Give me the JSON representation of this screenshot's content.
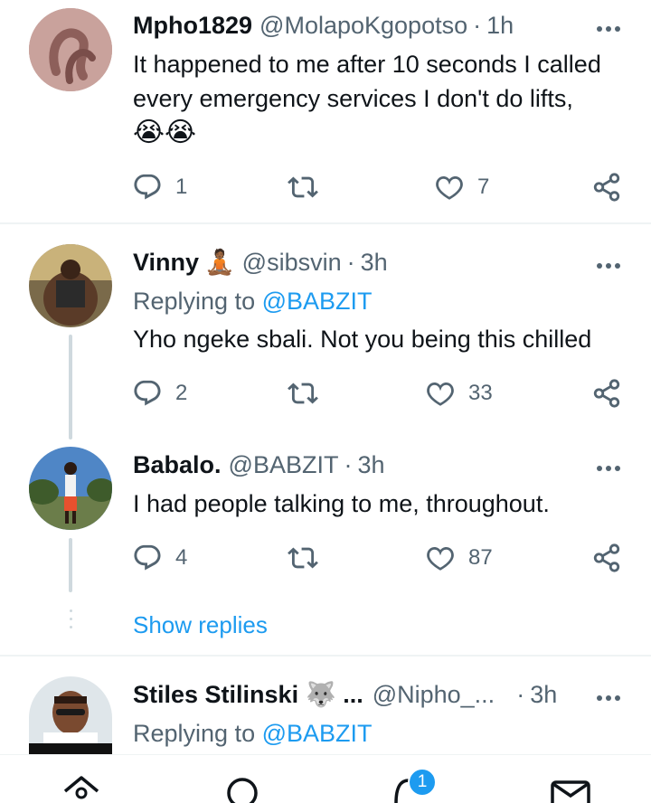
{
  "tweets": [
    {
      "name": "Mpho1829",
      "emoji_after_name": "",
      "handle": "@MolapoKgopotso",
      "dot": "·",
      "time": "1h",
      "text": "It happened to me after 10 seconds I called every emergency services I don't do lifts,",
      "emojis": "😭😭",
      "replies": "1",
      "retweets": "",
      "likes": "7"
    },
    {
      "name": "Vinny",
      "emoji_after_name": "🧘🏾",
      "handle": "@sibsvin",
      "dot": "·",
      "time": "3h",
      "replying_label": "Replying to",
      "replying_mention": "@BABZIT",
      "text": "Yho ngeke sbali. Not you being this chilled",
      "replies": "2",
      "retweets": "",
      "likes": "33"
    },
    {
      "name": "Babalo.",
      "handle": "@BABZIT",
      "dot": "·",
      "time": "3h",
      "text": "I had people talking to me, throughout.",
      "replies": "4",
      "retweets": "",
      "likes": "87"
    },
    {
      "name": "Stiles Stilinski",
      "emoji_after_name": "🐺 ...",
      "handle": "@Nipho_...",
      "dot": "·",
      "time": "3h",
      "replying_label": "Replying to",
      "replying_mention": "@BABZIT"
    }
  ],
  "show_replies": "Show replies",
  "nav": {
    "notifications_badge": "1"
  },
  "icons": {
    "reply": "reply-icon",
    "retweet": "retweet-icon",
    "like": "heart-icon",
    "share": "share-icon",
    "more": "more-icon",
    "home": "home-icon",
    "search": "search-icon",
    "notifications": "bell-icon",
    "messages": "mail-icon"
  },
  "colors": {
    "accent": "#1d9bf0",
    "secondary_text": "#536471",
    "divider": "#eff3f4",
    "thread_line": "#cfd9de"
  }
}
